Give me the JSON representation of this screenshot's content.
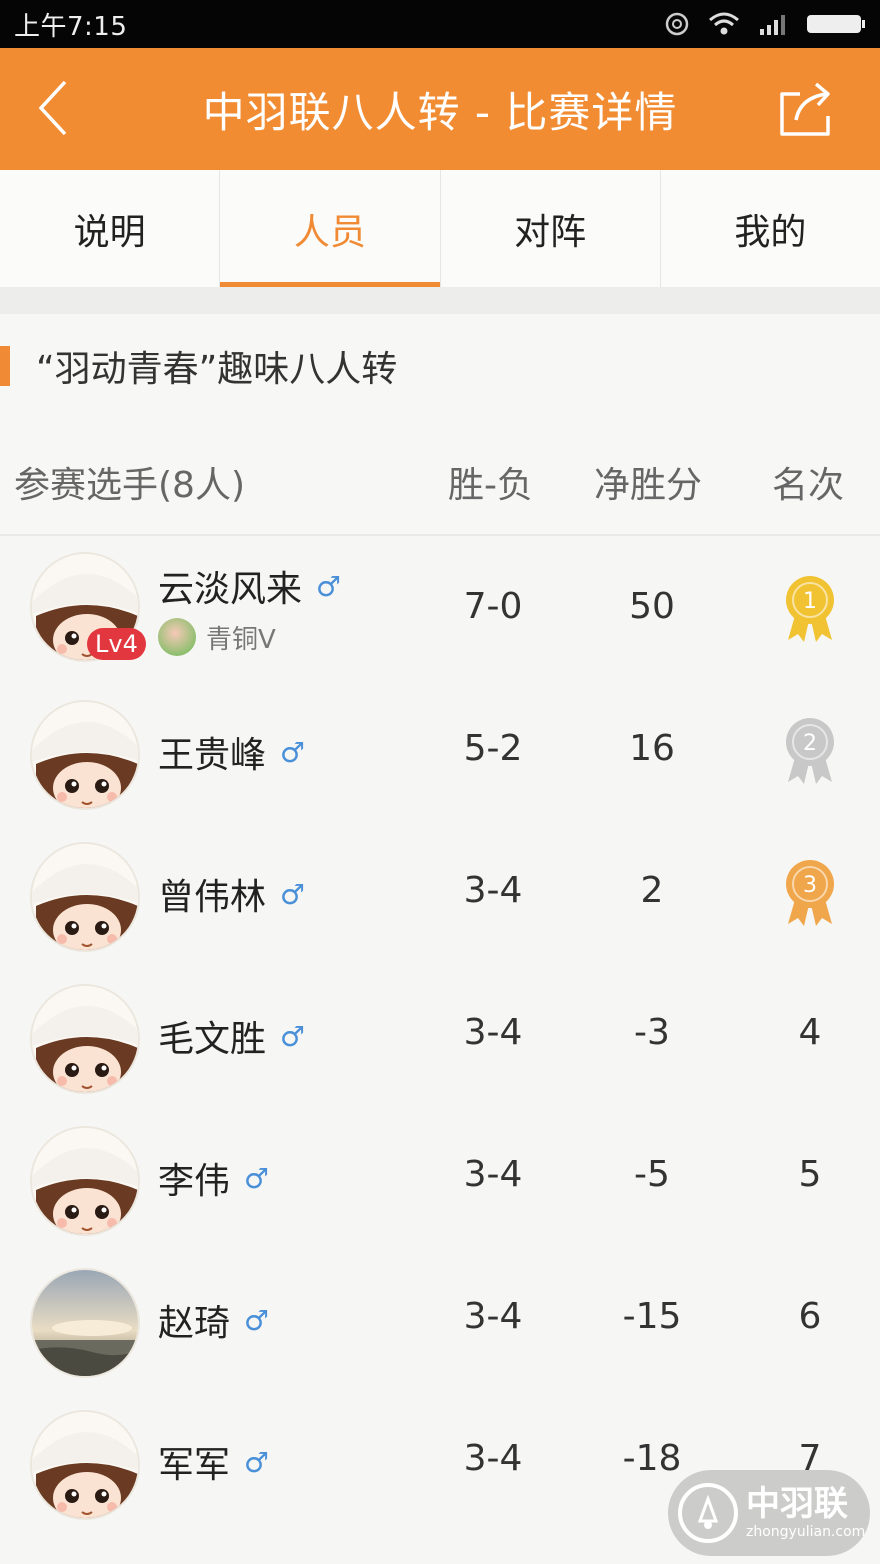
{
  "status": {
    "time": "上午7:15"
  },
  "nav": {
    "title": "中羽联八人转 - 比赛详情"
  },
  "tabs": [
    {
      "label": "说明"
    },
    {
      "label": "人员",
      "active": true
    },
    {
      "label": "对阵"
    },
    {
      "label": "我的"
    }
  ],
  "event": {
    "name": "“羽动青春”趣味八人转"
  },
  "columns": {
    "player": "参赛选手(8人)",
    "wl": "胜-负",
    "net": "净胜分",
    "rank": "名次"
  },
  "players": [
    {
      "name": "云淡风来",
      "gender": "♂",
      "level": "Lv4",
      "badge": "青铜V",
      "wl": "7-0",
      "net": "50",
      "rank": "1",
      "medal": "gold"
    },
    {
      "name": "王贵峰",
      "gender": "♂",
      "wl": "5-2",
      "net": "16",
      "rank": "2",
      "medal": "silver"
    },
    {
      "name": "曾伟林",
      "gender": "♂",
      "wl": "3-4",
      "net": "2",
      "rank": "3",
      "medal": "bronze"
    },
    {
      "name": "毛文胜",
      "gender": "♂",
      "wl": "3-4",
      "net": "-3",
      "rank": "4"
    },
    {
      "name": "李伟",
      "gender": "♂",
      "wl": "3-4",
      "net": "-5",
      "rank": "5"
    },
    {
      "name": "赵琦",
      "gender": "♂",
      "wl": "3-4",
      "net": "-15",
      "rank": "6",
      "avatar": "photo"
    },
    {
      "name": "军军",
      "gender": "♂",
      "wl": "3-4",
      "net": "-18",
      "rank": "7"
    }
  ],
  "watermark": {
    "name": "中羽联",
    "url": "zhongyulian.com"
  },
  "colors": {
    "accent": "#f28c33",
    "gold": "#f1c232",
    "silver": "#c8c8c8",
    "bronze": "#f0a64a",
    "male": "#4a90d8",
    "level": "#e2373f"
  }
}
